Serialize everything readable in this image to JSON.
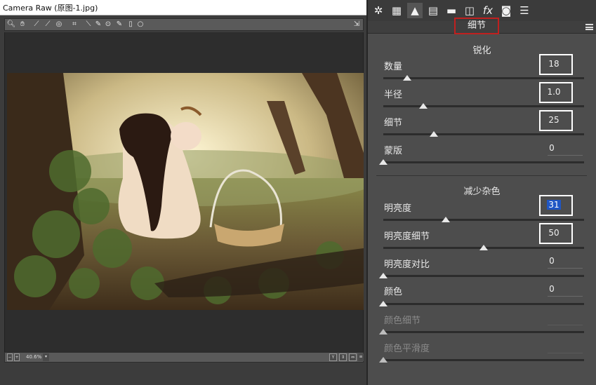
{
  "window": {
    "title": "Camera Raw (原图-1.jpg)"
  },
  "status": {
    "zoom": "40.6%"
  },
  "bottom": {
    "preview_label": "Y"
  },
  "panel": {
    "name": "细节",
    "sharpening": {
      "title": "锐化",
      "sliders": [
        {
          "label": "数量",
          "value": "18",
          "fraction": 0.12
        },
        {
          "label": "半径",
          "value": "1.0",
          "fraction": 0.2
        },
        {
          "label": "细节",
          "value": "25",
          "fraction": 0.25
        },
        {
          "label": "蒙版",
          "value": "0",
          "fraction": 0.0
        }
      ]
    },
    "noise": {
      "title": "减少杂色",
      "sliders": [
        {
          "label": "明亮度",
          "value": "31",
          "fraction": 0.31
        },
        {
          "label": "明亮度细节",
          "value": "50",
          "fraction": 0.5
        },
        {
          "label": "明亮度对比",
          "value": "0",
          "fraction": 0.0
        },
        {
          "label": "颜色",
          "value": "0",
          "fraction": 0.0
        },
        {
          "label": "颜色细节",
          "value": "",
          "fraction": 0.0
        },
        {
          "label": "颜色平滑度",
          "value": "",
          "fraction": 0.0
        }
      ]
    }
  },
  "icons": {
    "tools": [
      "zoom-icon",
      "hand-icon",
      "white-balance-icon",
      "color-sampler-icon",
      "target-adjust-icon",
      "crop-icon",
      "straighten-icon",
      "spot-removal-icon",
      "red-eye-icon",
      "adjustment-brush-icon",
      "graduated-filter-icon",
      "radial-filter-icon"
    ],
    "tabs": [
      "basic-icon",
      "tone-curve-icon",
      "detail-icon",
      "hsl-icon",
      "split-toning-icon",
      "lens-icon",
      "fx-icon",
      "camera-calibration-icon",
      "presets-icon"
    ]
  },
  "colors": {
    "highlight_box": "#c0201f",
    "selection": "#1f56c4"
  }
}
